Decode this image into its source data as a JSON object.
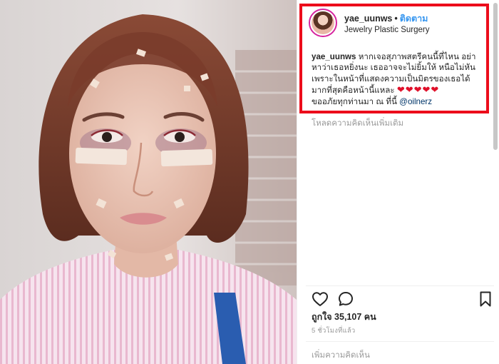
{
  "post": {
    "username": "yae_uunws",
    "separator": "•",
    "follow_label": "ติดตาม",
    "location": "Jewelry Plastic Surgery"
  },
  "caption": {
    "username": "yae_uunws",
    "line1_text": " หากเจอสุภาพสตรีคนนี้ที่ไหน อย่า",
    "line2": "หาว่าเธอหยิ่งนะ เธออาจจะไม่ยิ้มให้ หนือไม่หัน",
    "line3": "เพราะในหน้าที่แสดงความเป็นมิตรของเธอได้",
    "line4_text": "มากที่สุดคือหน้านี้แหละ ",
    "line4_hearts": "❤❤❤❤❤",
    "line5_text": "ขออภัยทุกท่านมา ณ ที่นี้ ",
    "mention": "@oilnerz"
  },
  "load_more_comments": "โหลดความคิดเห็นเพิ่มเติม",
  "likes_text": "ถูกใจ 35,107 คน",
  "time_text": "5 ชั่วโมงที่แล้ว",
  "add_comment_placeholder": "เพิ่มความคิดเห็น",
  "colors": {
    "highlight_border": "#ec0d1b",
    "follow_blue": "#3897f0",
    "mention_blue": "#003569",
    "heart_red": "#e0102a",
    "muted_text": "#999999"
  },
  "icons": {
    "like": "heart-outline-icon",
    "comment": "speech-bubble-icon",
    "save": "bookmark-icon"
  }
}
